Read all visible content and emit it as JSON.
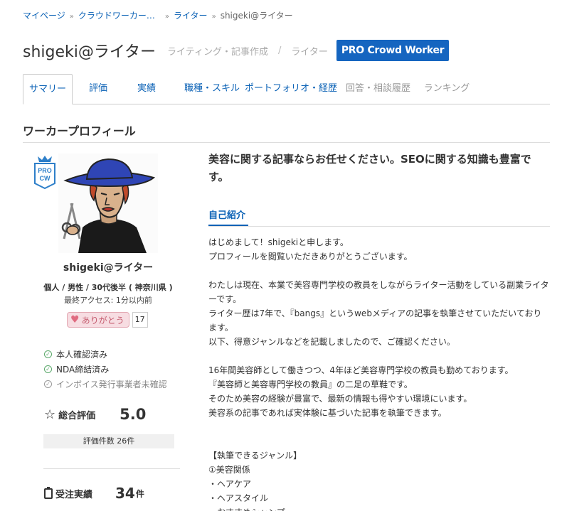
{
  "breadcrumb": {
    "items": [
      "マイページ",
      "クラウドワーカー…",
      "ライター",
      "shigeki@ライター"
    ],
    "separator": "»"
  },
  "header": {
    "name": "shigeki@ライター",
    "category": "ライティング・記事作成",
    "slash": "/",
    "role": "ライター",
    "badge": "PRO Crowd Worker"
  },
  "tabs": [
    "サマリー",
    "評価",
    "実績",
    "職種・スキル",
    "ポートフォリオ・経歴",
    "回答・相談履歴",
    "ランキング"
  ],
  "section": {
    "title": "ワーカープロフィール"
  },
  "profile": {
    "emblem_top": "PRO",
    "emblem_bottom": "CW",
    "name": "shigeki@ライター",
    "info": "個人 / 男性 / 30代後半 ( 神奈川県 )",
    "last_access": "最終アクセス: 1分以内前",
    "thanks_label": "ありがとう",
    "thanks_count": "17",
    "verifications": [
      "本人確認済み",
      "NDA締結済み",
      "インボイス発行事業者未確認"
    ],
    "rating_label": "総合評価",
    "rating_value": "5.0",
    "review_count": "評価件数 26件",
    "jobs_label": "受注実績",
    "jobs_count": "34",
    "jobs_unit": "件"
  },
  "main": {
    "catchphrase": "美容に関する記事ならお任せください。SEOに関する知識も豊富です。",
    "intro_tab": "自己紹介",
    "intro_lines": [
      "はじめまして！shigekiと申します。",
      "プロフィールを閲覧いただきありがとうございます。",
      "",
      "わたしは現在、本業で美容専門学校の教員をしながらライター活動をしている副業ライターです。",
      "ライター歴は7年で、『bangs』というwebメディアの記事を執筆させていただいております。",
      "以下、得意ジャンルなどを記載しましたので、ご確認ください。",
      "",
      "16年間美容師として働きつつ、4年ほど美容専門学校の教員も勤めております。",
      "『美容師と美容専門学校の教員』の二足の草鞋です。",
      "そのため美容の経験が豊富で、最新の情報も得やすい環境にいます。",
      "美容系の記事であれば実体験に基づいた記事を執筆できます。",
      "",
      "",
      "【執筆できるジャンル】",
      "①美容関係",
      "・ヘアケア",
      "・ヘアスタイル",
      "・おすすめシャンプー"
    ]
  },
  "colors": {
    "link": "#0b62b6",
    "badge": "#1565c0",
    "thanks": "#f7dde2",
    "check": "#5aa86a"
  }
}
